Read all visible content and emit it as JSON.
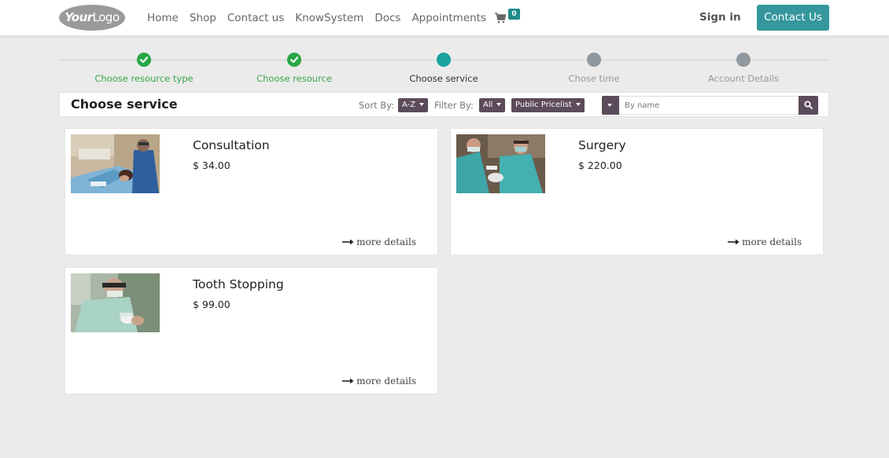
{
  "navbar": {
    "logo": {
      "bold": "Your",
      "normal": "Logo"
    },
    "links": [
      "Home",
      "Shop",
      "Contact us",
      "KnowSystem",
      "Docs",
      "Appointments"
    ],
    "cart_count": "0",
    "signin": "Sign in",
    "contact_button": "Contact Us"
  },
  "steps": [
    {
      "label": "Choose resource type",
      "state": "done"
    },
    {
      "label": "Choose resource",
      "state": "done"
    },
    {
      "label": "Choose service",
      "state": "active"
    },
    {
      "label": "Chose time",
      "state": "todo"
    },
    {
      "label": "Account Details",
      "state": "todo"
    }
  ],
  "toolbar": {
    "title": "Choose service",
    "sort_label": "Sort By:",
    "sort_value": "A-Z",
    "filter_label": "Filter By:",
    "filter_value": "All",
    "pricelist_value": "Public Pricelist",
    "search_placeholder": "By name"
  },
  "services": [
    {
      "name": "Consultation",
      "price": "$ 34.00",
      "more": "more details"
    },
    {
      "name": "Surgery",
      "price": "$ 220.00",
      "more": "more details"
    },
    {
      "name": "Tooth Stopping",
      "price": "$ 99.00",
      "more": "more details"
    }
  ],
  "colors": {
    "accent": "#35979c",
    "done": "#28a745",
    "active": "#17a2a0",
    "todo": "#8f979f",
    "dropdown": "#5c4b5a"
  }
}
